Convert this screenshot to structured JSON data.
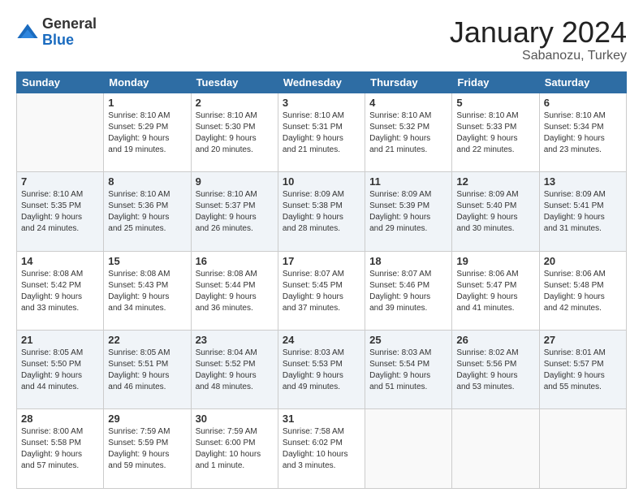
{
  "logo": {
    "general": "General",
    "blue": "Blue"
  },
  "title": {
    "month": "January 2024",
    "location": "Sabanozu, Turkey"
  },
  "headers": [
    "Sunday",
    "Monday",
    "Tuesday",
    "Wednesday",
    "Thursday",
    "Friday",
    "Saturday"
  ],
  "weeks": [
    [
      {
        "day": "",
        "info": ""
      },
      {
        "day": "1",
        "info": "Sunrise: 8:10 AM\nSunset: 5:29 PM\nDaylight: 9 hours\nand 19 minutes."
      },
      {
        "day": "2",
        "info": "Sunrise: 8:10 AM\nSunset: 5:30 PM\nDaylight: 9 hours\nand 20 minutes."
      },
      {
        "day": "3",
        "info": "Sunrise: 8:10 AM\nSunset: 5:31 PM\nDaylight: 9 hours\nand 21 minutes."
      },
      {
        "day": "4",
        "info": "Sunrise: 8:10 AM\nSunset: 5:32 PM\nDaylight: 9 hours\nand 21 minutes."
      },
      {
        "day": "5",
        "info": "Sunrise: 8:10 AM\nSunset: 5:33 PM\nDaylight: 9 hours\nand 22 minutes."
      },
      {
        "day": "6",
        "info": "Sunrise: 8:10 AM\nSunset: 5:34 PM\nDaylight: 9 hours\nand 23 minutes."
      }
    ],
    [
      {
        "day": "7",
        "info": "Sunrise: 8:10 AM\nSunset: 5:35 PM\nDaylight: 9 hours\nand 24 minutes."
      },
      {
        "day": "8",
        "info": "Sunrise: 8:10 AM\nSunset: 5:36 PM\nDaylight: 9 hours\nand 25 minutes."
      },
      {
        "day": "9",
        "info": "Sunrise: 8:10 AM\nSunset: 5:37 PM\nDaylight: 9 hours\nand 26 minutes."
      },
      {
        "day": "10",
        "info": "Sunrise: 8:09 AM\nSunset: 5:38 PM\nDaylight: 9 hours\nand 28 minutes."
      },
      {
        "day": "11",
        "info": "Sunrise: 8:09 AM\nSunset: 5:39 PM\nDaylight: 9 hours\nand 29 minutes."
      },
      {
        "day": "12",
        "info": "Sunrise: 8:09 AM\nSunset: 5:40 PM\nDaylight: 9 hours\nand 30 minutes."
      },
      {
        "day": "13",
        "info": "Sunrise: 8:09 AM\nSunset: 5:41 PM\nDaylight: 9 hours\nand 31 minutes."
      }
    ],
    [
      {
        "day": "14",
        "info": "Sunrise: 8:08 AM\nSunset: 5:42 PM\nDaylight: 9 hours\nand 33 minutes."
      },
      {
        "day": "15",
        "info": "Sunrise: 8:08 AM\nSunset: 5:43 PM\nDaylight: 9 hours\nand 34 minutes."
      },
      {
        "day": "16",
        "info": "Sunrise: 8:08 AM\nSunset: 5:44 PM\nDaylight: 9 hours\nand 36 minutes."
      },
      {
        "day": "17",
        "info": "Sunrise: 8:07 AM\nSunset: 5:45 PM\nDaylight: 9 hours\nand 37 minutes."
      },
      {
        "day": "18",
        "info": "Sunrise: 8:07 AM\nSunset: 5:46 PM\nDaylight: 9 hours\nand 39 minutes."
      },
      {
        "day": "19",
        "info": "Sunrise: 8:06 AM\nSunset: 5:47 PM\nDaylight: 9 hours\nand 41 minutes."
      },
      {
        "day": "20",
        "info": "Sunrise: 8:06 AM\nSunset: 5:48 PM\nDaylight: 9 hours\nand 42 minutes."
      }
    ],
    [
      {
        "day": "21",
        "info": "Sunrise: 8:05 AM\nSunset: 5:50 PM\nDaylight: 9 hours\nand 44 minutes."
      },
      {
        "day": "22",
        "info": "Sunrise: 8:05 AM\nSunset: 5:51 PM\nDaylight: 9 hours\nand 46 minutes."
      },
      {
        "day": "23",
        "info": "Sunrise: 8:04 AM\nSunset: 5:52 PM\nDaylight: 9 hours\nand 48 minutes."
      },
      {
        "day": "24",
        "info": "Sunrise: 8:03 AM\nSunset: 5:53 PM\nDaylight: 9 hours\nand 49 minutes."
      },
      {
        "day": "25",
        "info": "Sunrise: 8:03 AM\nSunset: 5:54 PM\nDaylight: 9 hours\nand 51 minutes."
      },
      {
        "day": "26",
        "info": "Sunrise: 8:02 AM\nSunset: 5:56 PM\nDaylight: 9 hours\nand 53 minutes."
      },
      {
        "day": "27",
        "info": "Sunrise: 8:01 AM\nSunset: 5:57 PM\nDaylight: 9 hours\nand 55 minutes."
      }
    ],
    [
      {
        "day": "28",
        "info": "Sunrise: 8:00 AM\nSunset: 5:58 PM\nDaylight: 9 hours\nand 57 minutes."
      },
      {
        "day": "29",
        "info": "Sunrise: 7:59 AM\nSunset: 5:59 PM\nDaylight: 9 hours\nand 59 minutes."
      },
      {
        "day": "30",
        "info": "Sunrise: 7:59 AM\nSunset: 6:00 PM\nDaylight: 10 hours\nand 1 minute."
      },
      {
        "day": "31",
        "info": "Sunrise: 7:58 AM\nSunset: 6:02 PM\nDaylight: 10 hours\nand 3 minutes."
      },
      {
        "day": "",
        "info": ""
      },
      {
        "day": "",
        "info": ""
      },
      {
        "day": "",
        "info": ""
      }
    ]
  ]
}
